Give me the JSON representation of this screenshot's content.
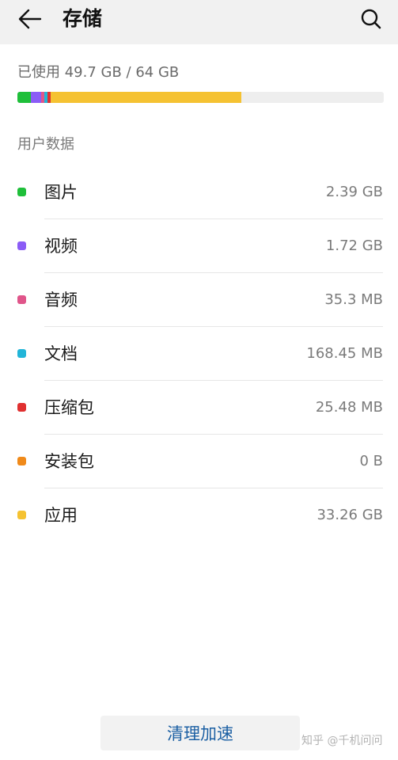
{
  "header": {
    "title": "存储",
    "back_icon": "arrow-left-icon",
    "search_icon": "search-icon"
  },
  "usage": {
    "text": "已使用 49.7 GB / 64 GB",
    "used_gb": 49.7,
    "total_gb": 64
  },
  "section_title": "用户数据",
  "categories": [
    {
      "label": "图片",
      "size": "2.39 GB",
      "color": "#1fbf3a"
    },
    {
      "label": "视频",
      "size": "1.72 GB",
      "color": "#8b5cf6"
    },
    {
      "label": "音频",
      "size": "35.3 MB",
      "color": "#e0558a"
    },
    {
      "label": "文档",
      "size": "168.45 MB",
      "color": "#22b5d8"
    },
    {
      "label": "压缩包",
      "size": "25.48 MB",
      "color": "#e03030"
    },
    {
      "label": "安装包",
      "size": "0 B",
      "color": "#f08a1a"
    },
    {
      "label": "应用",
      "size": "33.26 GB",
      "color": "#f5c232"
    }
  ],
  "action": {
    "label": "清理加速"
  },
  "watermark": "知乎 @千机问问"
}
